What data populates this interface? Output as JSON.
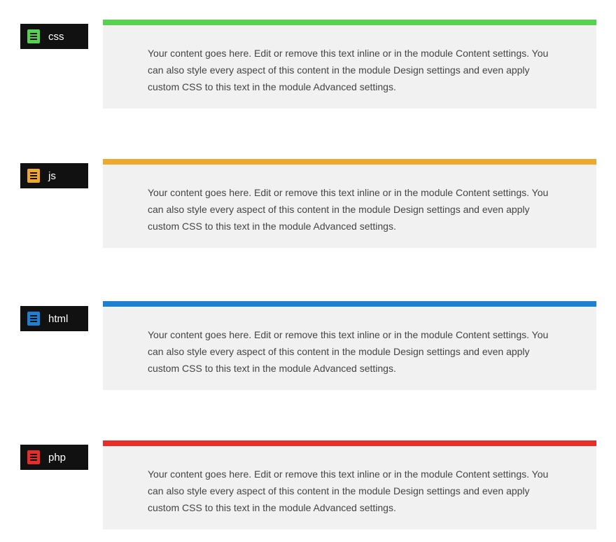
{
  "blocks": [
    {
      "label": "css",
      "color": "#58d052",
      "content": "Your content goes here. Edit or remove this text inline or in the module Content settings. You can also style every aspect of this content in the module Design settings and even apply custom CSS to this text in the module Advanced settings."
    },
    {
      "label": "js",
      "color": "#efa82e",
      "content": "Your content goes here. Edit or remove this text inline or in the module Content settings. You can also style every aspect of this content in the module Design settings and even apply custom CSS to this text in the module Advanced settings."
    },
    {
      "label": "html",
      "color": "#1f7fd3",
      "content": "Your content goes here. Edit or remove this text inline or in the module Content settings. You can also style every aspect of this content in the module Design settings and even apply custom CSS to this text in the module Advanced settings."
    },
    {
      "label": "php",
      "color": "#ea2c26",
      "content": "Your content goes here. Edit or remove this text inline or in the module Content settings. You can also style every aspect of this content in the module Design settings and even apply custom CSS to this text in the module Advanced settings."
    }
  ],
  "layout": {
    "cardTops": [
      28,
      227,
      430,
      629
    ],
    "tagTops": [
      34,
      233,
      437,
      635
    ]
  }
}
